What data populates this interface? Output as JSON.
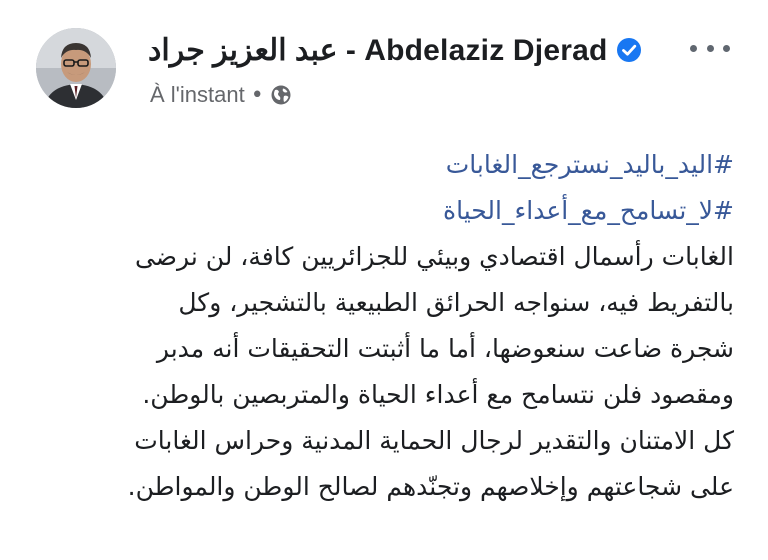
{
  "post": {
    "author": {
      "name": "عبد العزيز جراد - Abdelaziz Djerad",
      "verified": true
    },
    "timestamp": "À l'instant",
    "separator": "•",
    "audience_icon": "globe-icon",
    "more_icon": "more-horizontal-icon",
    "hashtags": [
      "#اليد_باليد_نسترجع_الغابات",
      "#لا_تسامح_مع_أعداء_الحياة"
    ],
    "text_lines": [
      "الغابات رأسمال اقتصادي وبيئي للجزائريين كافة، لن نرضى",
      "بالتفريط فيه، سنواجه الحرائق الطبيعية بالتشجير، وكل",
      "شجرة ضاعت سنعوضها، أما ما أثبتت التحقيقات أنه مدبر",
      "ومقصود فلن نتسامح مع أعداء الحياة والمتربصين بالوطن.",
      "كل الامتنان والتقدير لرجال الحماية المدنية وحراس الغابات",
      "على شجاعتهم وإخلاصهم وتجنّدهم لصالح الوطن والمواطن."
    ],
    "colors": {
      "name": "#1c1e21",
      "meta": "#65676b",
      "hashtag": "#385898",
      "verified": "#1877f2"
    }
  }
}
